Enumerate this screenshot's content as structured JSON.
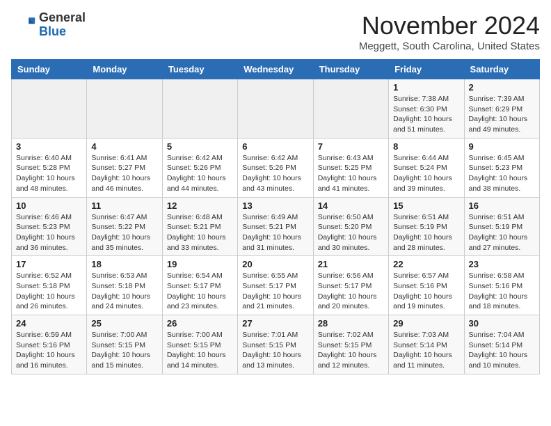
{
  "header": {
    "logo_general": "General",
    "logo_blue": "Blue",
    "month_title": "November 2024",
    "location": "Meggett, South Carolina, United States"
  },
  "weekdays": [
    "Sunday",
    "Monday",
    "Tuesday",
    "Wednesday",
    "Thursday",
    "Friday",
    "Saturday"
  ],
  "weeks": [
    [
      {
        "day": "",
        "info": ""
      },
      {
        "day": "",
        "info": ""
      },
      {
        "day": "",
        "info": ""
      },
      {
        "day": "",
        "info": ""
      },
      {
        "day": "",
        "info": ""
      },
      {
        "day": "1",
        "info": "Sunrise: 7:38 AM\nSunset: 6:30 PM\nDaylight: 10 hours\nand 51 minutes."
      },
      {
        "day": "2",
        "info": "Sunrise: 7:39 AM\nSunset: 6:29 PM\nDaylight: 10 hours\nand 49 minutes."
      }
    ],
    [
      {
        "day": "3",
        "info": "Sunrise: 6:40 AM\nSunset: 5:28 PM\nDaylight: 10 hours\nand 48 minutes."
      },
      {
        "day": "4",
        "info": "Sunrise: 6:41 AM\nSunset: 5:27 PM\nDaylight: 10 hours\nand 46 minutes."
      },
      {
        "day": "5",
        "info": "Sunrise: 6:42 AM\nSunset: 5:26 PM\nDaylight: 10 hours\nand 44 minutes."
      },
      {
        "day": "6",
        "info": "Sunrise: 6:42 AM\nSunset: 5:26 PM\nDaylight: 10 hours\nand 43 minutes."
      },
      {
        "day": "7",
        "info": "Sunrise: 6:43 AM\nSunset: 5:25 PM\nDaylight: 10 hours\nand 41 minutes."
      },
      {
        "day": "8",
        "info": "Sunrise: 6:44 AM\nSunset: 5:24 PM\nDaylight: 10 hours\nand 39 minutes."
      },
      {
        "day": "9",
        "info": "Sunrise: 6:45 AM\nSunset: 5:23 PM\nDaylight: 10 hours\nand 38 minutes."
      }
    ],
    [
      {
        "day": "10",
        "info": "Sunrise: 6:46 AM\nSunset: 5:23 PM\nDaylight: 10 hours\nand 36 minutes."
      },
      {
        "day": "11",
        "info": "Sunrise: 6:47 AM\nSunset: 5:22 PM\nDaylight: 10 hours\nand 35 minutes."
      },
      {
        "day": "12",
        "info": "Sunrise: 6:48 AM\nSunset: 5:21 PM\nDaylight: 10 hours\nand 33 minutes."
      },
      {
        "day": "13",
        "info": "Sunrise: 6:49 AM\nSunset: 5:21 PM\nDaylight: 10 hours\nand 31 minutes."
      },
      {
        "day": "14",
        "info": "Sunrise: 6:50 AM\nSunset: 5:20 PM\nDaylight: 10 hours\nand 30 minutes."
      },
      {
        "day": "15",
        "info": "Sunrise: 6:51 AM\nSunset: 5:19 PM\nDaylight: 10 hours\nand 28 minutes."
      },
      {
        "day": "16",
        "info": "Sunrise: 6:51 AM\nSunset: 5:19 PM\nDaylight: 10 hours\nand 27 minutes."
      }
    ],
    [
      {
        "day": "17",
        "info": "Sunrise: 6:52 AM\nSunset: 5:18 PM\nDaylight: 10 hours\nand 26 minutes."
      },
      {
        "day": "18",
        "info": "Sunrise: 6:53 AM\nSunset: 5:18 PM\nDaylight: 10 hours\nand 24 minutes."
      },
      {
        "day": "19",
        "info": "Sunrise: 6:54 AM\nSunset: 5:17 PM\nDaylight: 10 hours\nand 23 minutes."
      },
      {
        "day": "20",
        "info": "Sunrise: 6:55 AM\nSunset: 5:17 PM\nDaylight: 10 hours\nand 21 minutes."
      },
      {
        "day": "21",
        "info": "Sunrise: 6:56 AM\nSunset: 5:17 PM\nDaylight: 10 hours\nand 20 minutes."
      },
      {
        "day": "22",
        "info": "Sunrise: 6:57 AM\nSunset: 5:16 PM\nDaylight: 10 hours\nand 19 minutes."
      },
      {
        "day": "23",
        "info": "Sunrise: 6:58 AM\nSunset: 5:16 PM\nDaylight: 10 hours\nand 18 minutes."
      }
    ],
    [
      {
        "day": "24",
        "info": "Sunrise: 6:59 AM\nSunset: 5:16 PM\nDaylight: 10 hours\nand 16 minutes."
      },
      {
        "day": "25",
        "info": "Sunrise: 7:00 AM\nSunset: 5:15 PM\nDaylight: 10 hours\nand 15 minutes."
      },
      {
        "day": "26",
        "info": "Sunrise: 7:00 AM\nSunset: 5:15 PM\nDaylight: 10 hours\nand 14 minutes."
      },
      {
        "day": "27",
        "info": "Sunrise: 7:01 AM\nSunset: 5:15 PM\nDaylight: 10 hours\nand 13 minutes."
      },
      {
        "day": "28",
        "info": "Sunrise: 7:02 AM\nSunset: 5:15 PM\nDaylight: 10 hours\nand 12 minutes."
      },
      {
        "day": "29",
        "info": "Sunrise: 7:03 AM\nSunset: 5:14 PM\nDaylight: 10 hours\nand 11 minutes."
      },
      {
        "day": "30",
        "info": "Sunrise: 7:04 AM\nSunset: 5:14 PM\nDaylight: 10 hours\nand 10 minutes."
      }
    ]
  ]
}
